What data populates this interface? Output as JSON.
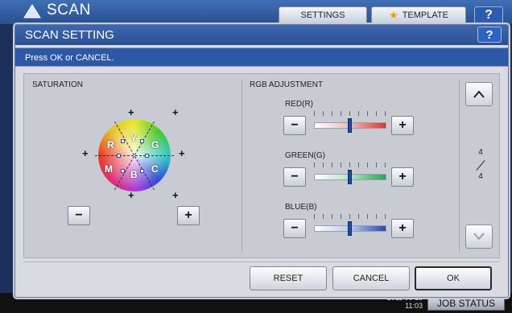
{
  "app": {
    "title": "SCAN",
    "settings_label": "SETTINGS",
    "template_label": "TEMPLATE",
    "help_label": "?"
  },
  "dialog": {
    "title": "SCAN SETTING",
    "help_label": "?",
    "message": "Press OK or CANCEL."
  },
  "saturation": {
    "label": "SATURATION",
    "wheel_labels": {
      "R": "R",
      "Y": "Y",
      "G": "G",
      "M": "M",
      "B": "B",
      "C": "C"
    },
    "minus_label": "−",
    "plus_label": "+"
  },
  "rgb": {
    "label": "RGB ADJUSTMENT",
    "channels": [
      {
        "name": "RED(R)",
        "minus": "−",
        "plus": "+",
        "color": "#e23232",
        "level": 0.5
      },
      {
        "name": "GREEN(G)",
        "minus": "−",
        "plus": "+",
        "color": "#22a650",
        "level": 0.5
      },
      {
        "name": "BLUE(B)",
        "minus": "−",
        "plus": "+",
        "color": "#2b47b8",
        "level": 0.5
      }
    ]
  },
  "pager": {
    "current": "4",
    "total": "4",
    "up_icon": "chevron-up-icon",
    "down_icon": "chevron-down-icon"
  },
  "buttons": {
    "reset": "RESET",
    "cancel": "CANCEL",
    "ok": "OK"
  },
  "footer": {
    "date": "2011 06 15",
    "time": "11:03",
    "job_status": "JOB STATUS"
  },
  "colors": {
    "title_bar": "#2b4f93",
    "message_bar": "#2d58a8",
    "panel": "#c8cbd2"
  }
}
